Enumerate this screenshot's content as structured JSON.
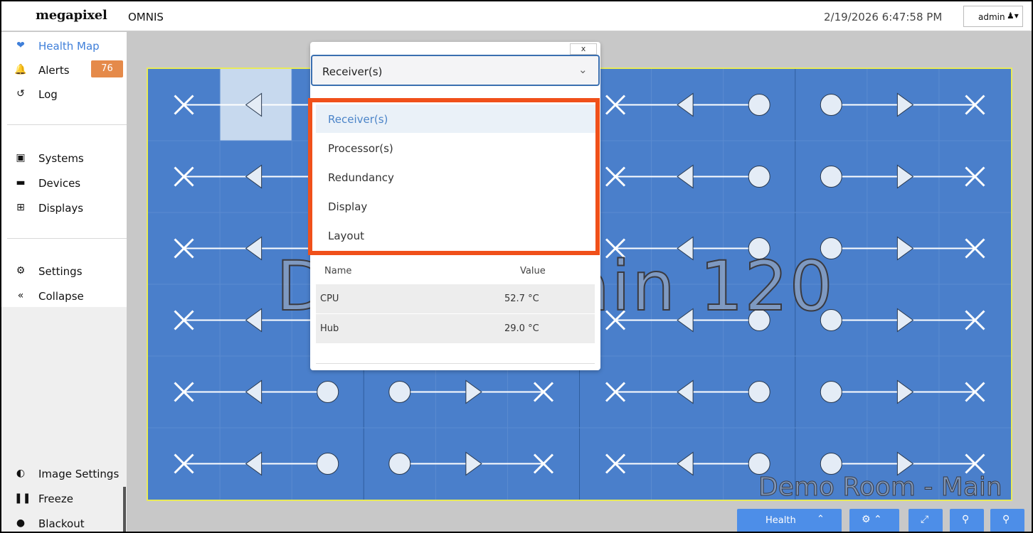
{
  "header": {
    "brand": "megapixel",
    "app_name": "OMNIS",
    "datetime": "2/19/2026 6:47:58 PM",
    "user": "admin",
    "user_icon": "user-caret-icon"
  },
  "sidebar": {
    "primary": [
      {
        "label": "Health Map",
        "icon": "heartbeat-icon",
        "active": true
      },
      {
        "label": "Alerts",
        "icon": "bell-icon",
        "badge": "76"
      },
      {
        "label": "Log",
        "icon": "history-icon"
      }
    ],
    "secondary": [
      {
        "label": "Systems",
        "icon": "network-icon"
      },
      {
        "label": "Devices",
        "icon": "server-icon"
      },
      {
        "label": "Displays",
        "icon": "grid-icon"
      }
    ],
    "tertiary": [
      {
        "label": "Settings",
        "icon": "gears-icon"
      },
      {
        "label": "Collapse",
        "icon": "double-chevron-left-icon"
      }
    ],
    "bottom": [
      {
        "label": "Image Settings",
        "icon": "contrast-icon"
      },
      {
        "label": "Freeze",
        "icon": "pause-icon"
      },
      {
        "label": "Blackout",
        "icon": "lightbulb-icon"
      }
    ]
  },
  "wall": {
    "name_overlay": "Demo Main 120",
    "room_label": "Demo Room - Main",
    "border_color": "#e8ea5a",
    "fill_color": "#4a7fcb"
  },
  "panel": {
    "close_label": "x",
    "selected": "Receiver(s)",
    "options": [
      "Receiver(s)",
      "Processor(s)",
      "Redundancy",
      "Display",
      "Layout"
    ],
    "table_headers": {
      "name": "Name",
      "value": "Value"
    },
    "rows": [
      {
        "name": "CPU",
        "value": "52.7 °C"
      },
      {
        "name": "Hub",
        "value": "29.0 °C"
      }
    ],
    "highlight_color": "#f0501a"
  },
  "toolbar": {
    "health_label": "Health",
    "accent": "#4d8ee8"
  }
}
